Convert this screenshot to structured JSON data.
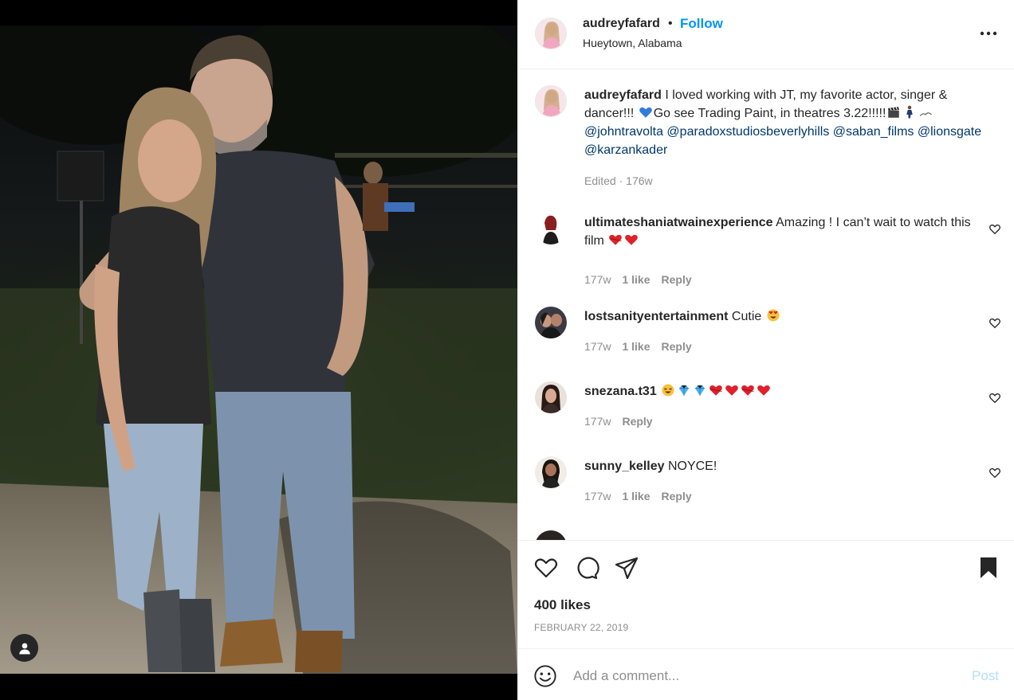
{
  "post": {
    "username": "audreyfafard",
    "follow_label": "Follow",
    "dot": "•",
    "location": "Hueytown, Alabama",
    "more_label": "•••"
  },
  "caption": {
    "username": "audreyfafard",
    "text_part1": " I loved working with JT, my favorite actor, singer & dancer!!! ",
    "text_part2": "Go see Trading Paint, in theatres 3.22!!!!!",
    "mentions": [
      "@johntravolta",
      "@paradoxstudiosbeverlyhills",
      "@saban_films",
      "@lionsgate",
      "@karzankader"
    ],
    "edited": "Edited",
    "time": "176w"
  },
  "comments": [
    {
      "username": "ultimateshaniatwainexperience",
      "text": " Amazing ! I can’t wait to watch this film ",
      "time": "177w",
      "likes": "1 like",
      "reply": "Reply"
    },
    {
      "username": "lostsanityentertainment",
      "text": " Cutie ",
      "time": "177w",
      "likes": "1 like",
      "reply": "Reply"
    },
    {
      "username": "snezana.t31",
      "text": " ",
      "time": "177w",
      "likes": "",
      "reply": "Reply"
    },
    {
      "username": "sunny_kelley",
      "text": " NOYCE!",
      "time": "177w",
      "likes": "1 like",
      "reply": "Reply"
    }
  ],
  "actions": {
    "likes": "400 likes",
    "date": "FEBRUARY 22, 2019"
  },
  "composer": {
    "placeholder": "Add a comment...",
    "post_label": "Post"
  },
  "colors": {
    "accent": "#0095f6",
    "mention": "#00376b",
    "muted": "#8e8e8e",
    "post_disabled": "#b2dffc"
  },
  "icons": [
    "user-tag-icon",
    "more-icon",
    "heart-icon",
    "comment-icon",
    "share-icon",
    "bookmark-icon",
    "smile-icon"
  ]
}
